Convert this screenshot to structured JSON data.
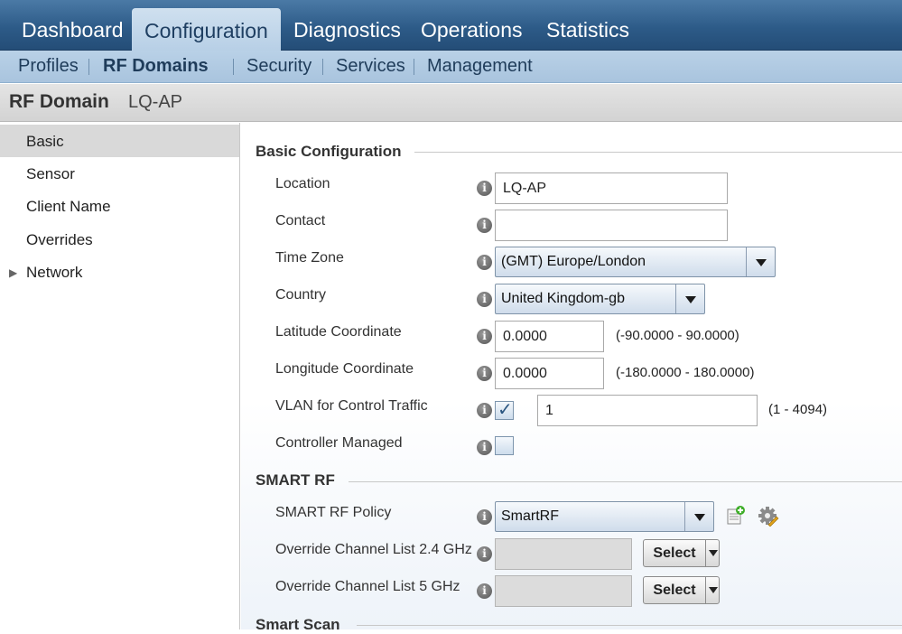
{
  "topnav": {
    "tabs": [
      {
        "label": "Dashboard"
      },
      {
        "label": "Configuration",
        "active": true
      },
      {
        "label": "Diagnostics"
      },
      {
        "label": "Operations"
      },
      {
        "label": "Statistics"
      }
    ]
  },
  "subnav": {
    "items": [
      {
        "label": "Profiles"
      },
      {
        "label": "RF Domains",
        "active": true
      },
      {
        "label": "Security"
      },
      {
        "label": "Services"
      },
      {
        "label": "Management"
      }
    ]
  },
  "title": {
    "heading": "RF Domain",
    "name": "LQ-AP"
  },
  "sidebar": {
    "items": [
      {
        "label": "Basic",
        "active": true
      },
      {
        "label": "Sensor"
      },
      {
        "label": "Client Name"
      },
      {
        "label": "Overrides"
      },
      {
        "label": "Network",
        "expandable": true
      }
    ]
  },
  "basic_config": {
    "title": "Basic Configuration",
    "location": {
      "label": "Location",
      "value": "LQ-AP"
    },
    "contact": {
      "label": "Contact",
      "value": ""
    },
    "time_zone": {
      "label": "Time Zone",
      "value": "(GMT) Europe/London"
    },
    "country": {
      "label": "Country",
      "value": "United Kingdom-gb"
    },
    "latitude": {
      "label": "Latitude Coordinate",
      "value": "0.0000",
      "range": "(-90.0000 - 90.0000)"
    },
    "longitude": {
      "label": "Longitude Coordinate",
      "value": "0.0000",
      "range": "(-180.0000 - 180.0000)"
    },
    "vlan": {
      "label": "VLAN for Control Traffic",
      "checked": true,
      "value": "1",
      "range": "(1 - 4094)"
    },
    "controller_managed": {
      "label": "Controller Managed",
      "checked": false
    }
  },
  "smart_rf": {
    "title": "SMART RF",
    "policy": {
      "label": "SMART RF Policy",
      "value": "SmartRF"
    },
    "override_24": {
      "label": "Override Channel List 2.4 GHz",
      "value": "",
      "button": "Select"
    },
    "override_5": {
      "label": "Override Channel List 5 GHz",
      "value": "",
      "button": "Select"
    }
  },
  "smart_scan": {
    "title": "Smart Scan"
  },
  "icons": {
    "info": "info-icon",
    "add": "add-policy-icon",
    "edit": "edit-policy-gear-icon",
    "check": "checkmark-icon",
    "expand": "triangle-right-icon"
  },
  "colors": {
    "nav_blue": "#2d5b88",
    "subnav_blue": "#b9d1e7",
    "active_tab": "#cfe0ef",
    "sidebar_active": "#d9d9d9"
  }
}
